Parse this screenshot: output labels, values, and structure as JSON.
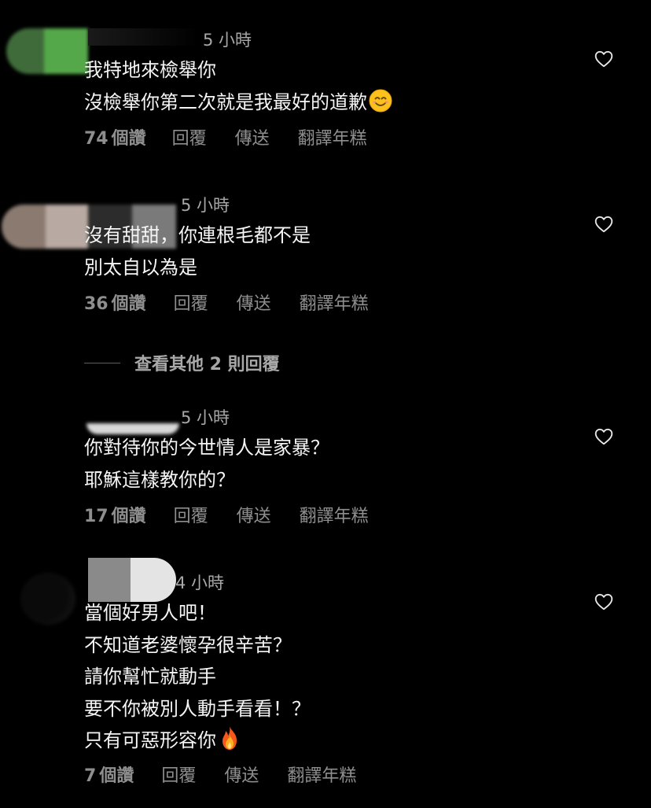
{
  "comments": [
    {
      "timestamp": "5 小時",
      "lines": [
        "我特地來檢舉你",
        "沒檢舉你第二次就是我最好的道歉"
      ],
      "emoji": "smiling-face-emoji",
      "likes_num": "74",
      "likes_unit": "個讚",
      "reply": "回覆",
      "send": "傳送",
      "translate": "翻譯年糕"
    },
    {
      "timestamp": "5 小時",
      "lines": [
        "沒有甜甜，你連根毛都不是",
        "別太自以為是"
      ],
      "likes_num": "36",
      "likes_unit": "個讚",
      "reply": "回覆",
      "send": "傳送",
      "translate": "翻譯年糕"
    },
    {
      "timestamp": "5 小時",
      "lines": [
        "你對待你的今世情人是家暴？",
        "耶穌這樣教你的？"
      ],
      "likes_num": "17",
      "likes_unit": "個讚",
      "reply": "回覆",
      "send": "傳送",
      "translate": "翻譯年糕"
    },
    {
      "timestamp": "4 小時",
      "lines": [
        "當個好男人吧！",
        "不知道老婆懷孕很辛苦？",
        "請你幫忙就動手",
        "要不你被別人動手看看！？",
        "只有可惡形容你"
      ],
      "emoji": "fire-emoji",
      "likes_num": "7",
      "likes_unit": "個讚",
      "reply": "回覆",
      "send": "傳送",
      "translate": "翻譯年糕"
    }
  ],
  "more_replies": "查看其他 2 則回覆",
  "icons": {
    "like": "heart-outline-icon"
  },
  "colors": {
    "background": "#000000",
    "text": "#f5f5f5",
    "muted": "#8e8e8e",
    "timestamp": "#a8a8a8"
  }
}
